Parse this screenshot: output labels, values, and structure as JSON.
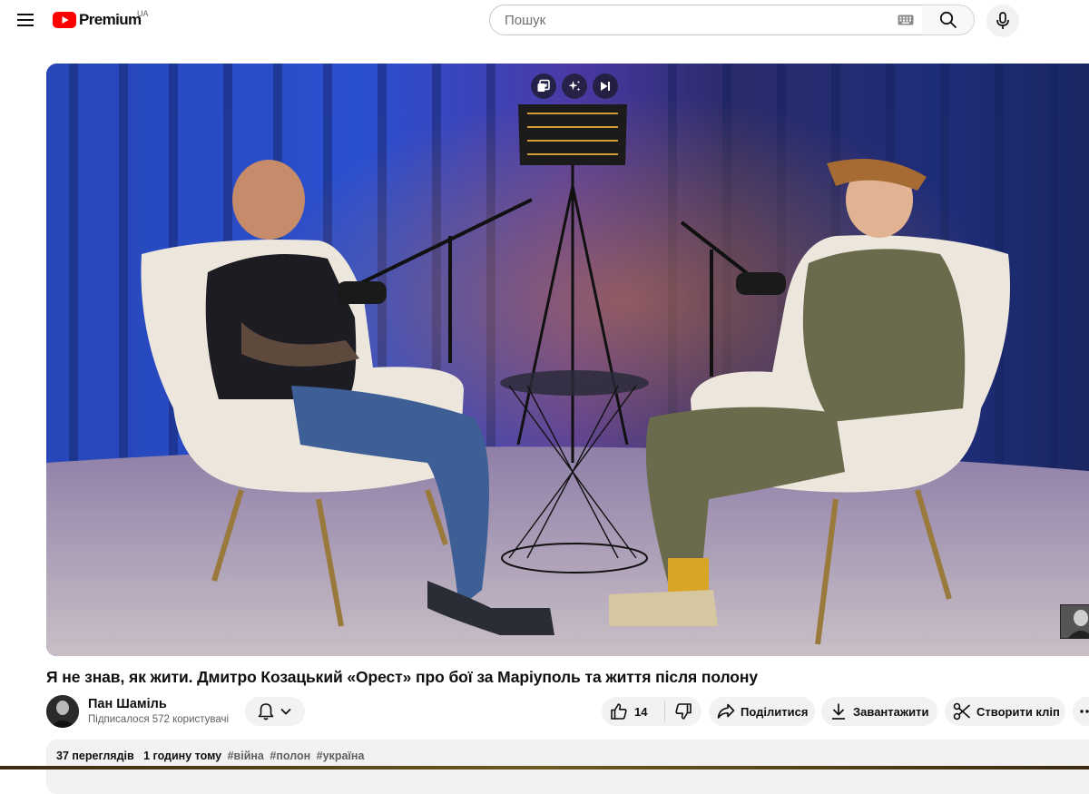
{
  "masthead": {
    "logo_text": "Premium",
    "region_code": "UA",
    "search_placeholder": "Пошук"
  },
  "video": {
    "title": "Я не знав, як жити. Дмитро Козацький «Орест» про бої за Маріуполь та життя після полону"
  },
  "channel": {
    "name": "Пан Шаміль",
    "subscribers": "Підписалося 572 користувачі"
  },
  "actions": {
    "like_count": "14",
    "share_label": "Поділитися",
    "download_label": "Завантажити",
    "clip_label": "Створити кліп"
  },
  "description": {
    "views": "37 переглядів",
    "time": "1 годину тому",
    "tags": [
      "#війна",
      "#полон",
      "#україна"
    ]
  },
  "colors": {
    "brand_red": "#ff0000",
    "pill_bg": "#f2f2f2",
    "text_primary": "#0f0f0f",
    "text_secondary": "#606060"
  },
  "icons": [
    "menu-icon",
    "youtube-logo-icon",
    "keyboard-icon",
    "search-icon",
    "mic-icon",
    "miniplayer-icon",
    "ai-sparkle-icon",
    "skip-next-icon",
    "bell-icon",
    "chevron-down-icon",
    "thumbs-up-icon",
    "thumbs-down-icon",
    "share-icon",
    "download-icon",
    "scissors-icon",
    "more-icon"
  ]
}
